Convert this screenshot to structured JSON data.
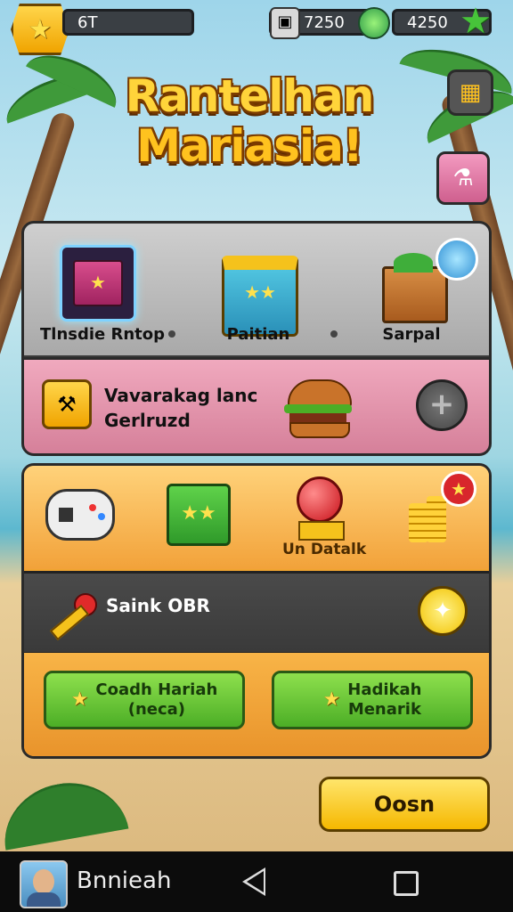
{
  "hud": {
    "level": "6T",
    "currency_a": "7250",
    "currency_b": "4250"
  },
  "title": {
    "line1": "Rantelhan",
    "line2": "Mariasia!"
  },
  "shop_items": [
    {
      "label": "Tlnsdie Rntop"
    },
    {
      "label": "Paitian"
    },
    {
      "label": "Sarpal"
    }
  ],
  "promo": {
    "line1": "Vavarakag lanc",
    "line2": "Gerlruzd"
  },
  "rewards": {
    "item_label": "Un Datalk"
  },
  "status_row": {
    "label": "Saink OBR"
  },
  "buttons": {
    "left_line1": "Coadh Hariah",
    "left_line2": "(neca)",
    "right_line1": "Hadikah",
    "right_line2": "Menarik",
    "open": "Oosn"
  },
  "navbar": {
    "user_name": "Bnnieah"
  },
  "colors": {
    "accent_gold": "#ffd43a",
    "green": "#4cae26",
    "pink": "#d47e98"
  }
}
